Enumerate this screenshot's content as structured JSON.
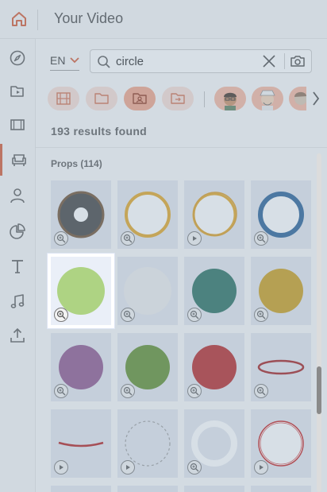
{
  "header": {
    "title": "Your Video",
    "home_icon": "home-icon",
    "accent": "#d4552e"
  },
  "rail": {
    "items": [
      {
        "name": "explore",
        "icon": "compass-icon"
      },
      {
        "name": "media",
        "icon": "folder-video-icon"
      },
      {
        "name": "video",
        "icon": "film-icon"
      },
      {
        "name": "props",
        "icon": "armchair-icon",
        "active": true
      },
      {
        "name": "characters",
        "icon": "person-icon"
      },
      {
        "name": "charts",
        "icon": "pie-chart-icon"
      },
      {
        "name": "text",
        "icon": "text-icon"
      },
      {
        "name": "music",
        "icon": "music-note-icon"
      },
      {
        "name": "upload",
        "icon": "upload-icon"
      }
    ]
  },
  "search": {
    "language": "EN",
    "query": "circle",
    "icons": [
      "search-icon",
      "clear-icon",
      "camera-icon"
    ]
  },
  "filters": {
    "chips": [
      {
        "name": "filter-film-grid",
        "icon": "film-grid-icon"
      },
      {
        "name": "filter-folder",
        "icon": "folder-icon"
      },
      {
        "name": "filter-folder-person",
        "icon": "folder-person-icon",
        "active": true
      },
      {
        "name": "filter-folder-arrow",
        "icon": "folder-arrow-icon"
      }
    ],
    "avatars": [
      "avatar-man-glasses",
      "avatar-man-hat",
      "avatar-partial"
    ],
    "next_icon": "chevron-right-icon"
  },
  "results": {
    "count_text": "193 results found",
    "section_label": "Props (114)"
  },
  "grid": {
    "tiles": [
      {
        "kind": "donut-dark",
        "badge": "zoom"
      },
      {
        "kind": "ring-gold",
        "badge": "zoom"
      },
      {
        "kind": "ring-gold-sketch",
        "badge": "play"
      },
      {
        "kind": "ring-blue",
        "badge": "zoom"
      },
      {
        "kind": "disc-light-green",
        "badge": "zoom",
        "selected": true
      },
      {
        "kind": "disc-light-gray",
        "badge": "zoom"
      },
      {
        "kind": "disc-teal",
        "badge": "zoom"
      },
      {
        "kind": "disc-mustard",
        "badge": "zoom"
      },
      {
        "kind": "disc-purple",
        "badge": "zoom"
      },
      {
        "kind": "disc-olive",
        "badge": "zoom"
      },
      {
        "kind": "disc-red",
        "badge": "zoom"
      },
      {
        "kind": "ellipse-red-stroke",
        "badge": "zoom"
      },
      {
        "kind": "arc-red",
        "badge": "play"
      },
      {
        "kind": "ring-dashed",
        "badge": "play"
      },
      {
        "kind": "ring-white",
        "badge": "zoom"
      },
      {
        "kind": "ring-red-thin",
        "badge": "play"
      }
    ]
  }
}
